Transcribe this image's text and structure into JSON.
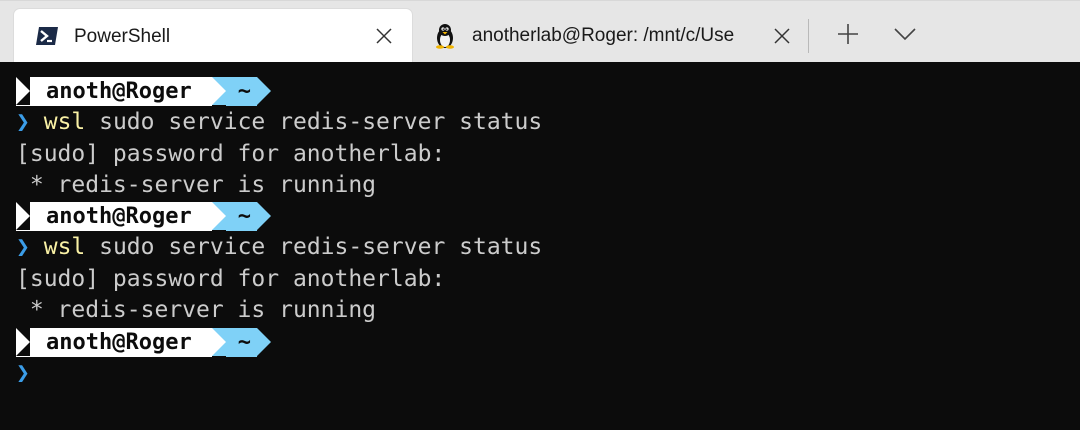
{
  "tabs": [
    {
      "title": "PowerShell",
      "icon": "powershell-icon",
      "active": true
    },
    {
      "title": "anotherlab@Roger: /mnt/c/Use",
      "icon": "linux-penguin-icon",
      "active": false
    }
  ],
  "titlebar": {
    "new_tab_icon": "plus-icon",
    "dropdown_icon": "chevron-down-icon"
  },
  "terminal": {
    "colors": {
      "background": "#0c0c0c",
      "foreground": "#cccccc",
      "prompt_user_bg": "#ffffff",
      "prompt_dir_bg": "#7fd1f7",
      "chevron": "#3b9de8",
      "command": "#f9f1a5"
    },
    "prompt_user": "anoth@Roger",
    "prompt_dir": "~",
    "chevron": "❯",
    "blocks": [
      {
        "command_exe": "wsl",
        "command_args": " sudo service redis-server status",
        "output": [
          "[sudo] password for anotherlab:",
          " * redis-server is running"
        ]
      },
      {
        "command_exe": "wsl",
        "command_args": " sudo service redis-server status",
        "output": [
          "[sudo] password for anotherlab:",
          " * redis-server is running"
        ]
      }
    ]
  }
}
